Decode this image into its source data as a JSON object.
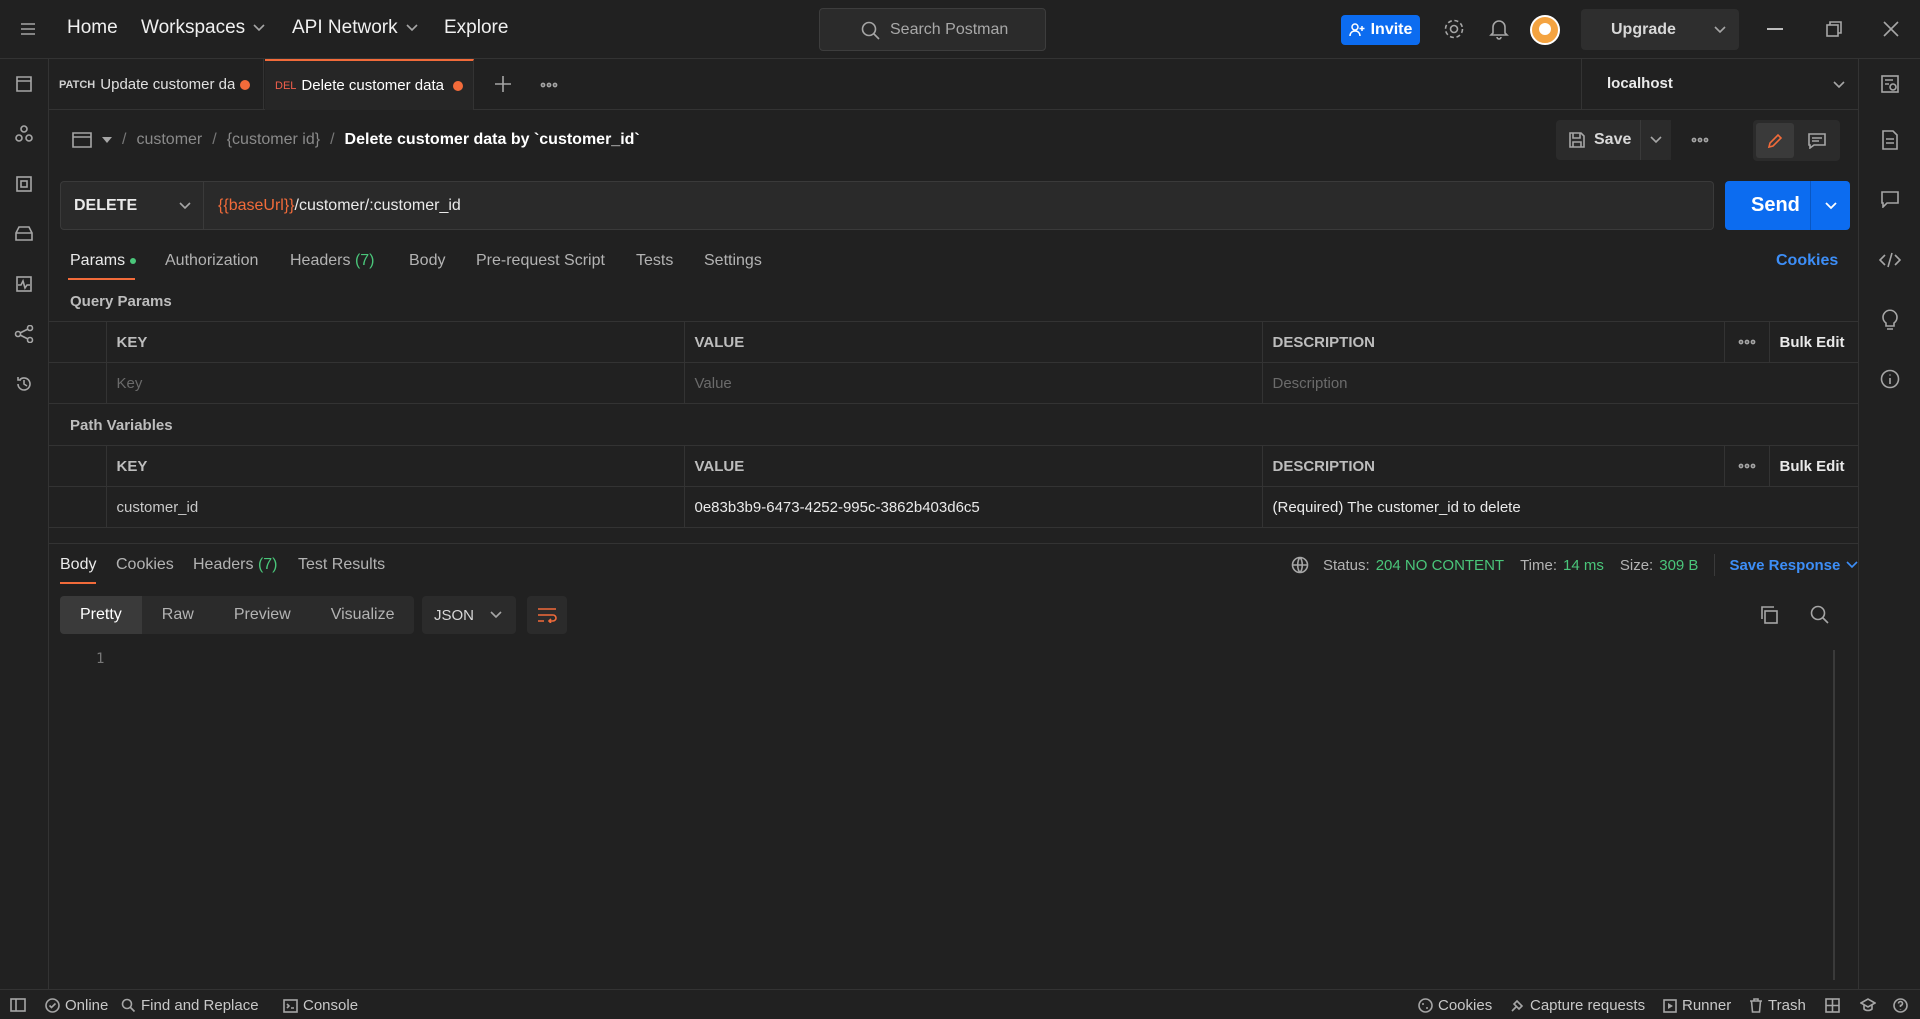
{
  "topnav": {
    "home": "Home",
    "workspaces": "Workspaces",
    "api_network": "API Network",
    "explore": "Explore",
    "search_placeholder": "Search Postman",
    "invite": "Invite",
    "upgrade": "Upgrade"
  },
  "tabs": [
    {
      "method": "PATCH",
      "title": "Update customer da",
      "method_color": "#d0d0d0"
    },
    {
      "method": "DEL",
      "title": "Delete customer data b",
      "method_color": "#f25f4c"
    }
  ],
  "environment": "localhost",
  "breadcrumb": {
    "part1": "customer",
    "part2": "{customer id}",
    "current": "Delete customer data by `customer_id`",
    "sep": "/"
  },
  "request": {
    "save_label": "Save",
    "method": "DELETE",
    "url_var": "{{baseUrl}}",
    "url_path": "/customer/:customer_id",
    "send_label": "Send"
  },
  "request_tabs": {
    "params": "Params",
    "authorization": "Authorization",
    "headers": "Headers",
    "headers_count": "(7)",
    "body": "Body",
    "prerequest": "Pre-request Script",
    "tests": "Tests",
    "settings": "Settings",
    "cookies": "Cookies"
  },
  "query_params": {
    "title": "Query Params",
    "col_key": "KEY",
    "col_value": "VALUE",
    "col_desc": "DESCRIPTION",
    "bulk_edit": "Bulk Edit",
    "key_placeholder": "Key",
    "value_placeholder": "Value",
    "desc_placeholder": "Description"
  },
  "path_vars": {
    "title": "Path Variables",
    "col_key": "KEY",
    "col_value": "VALUE",
    "col_desc": "DESCRIPTION",
    "bulk_edit": "Bulk Edit",
    "row": {
      "key": "customer_id",
      "value": "0e83b3b9-6473-4252-995c-3862b403d6c5",
      "desc": "(Required) The customer_id to delete"
    }
  },
  "response": {
    "tabs": {
      "body": "Body",
      "cookies": "Cookies",
      "headers": "Headers",
      "headers_count": "(7)",
      "test_results": "Test Results"
    },
    "status_label": "Status:",
    "status_value": "204 NO CONTENT",
    "time_label": "Time:",
    "time_value": "14 ms",
    "size_label": "Size:",
    "size_value": "309 B",
    "save_response": "Save Response",
    "views": {
      "pretty": "Pretty",
      "raw": "Raw",
      "preview": "Preview",
      "visualize": "Visualize"
    },
    "format": "JSON",
    "line_number": "1"
  },
  "statusbar": {
    "online": "Online",
    "find_replace": "Find and Replace",
    "console": "Console",
    "cookies": "Cookies",
    "capture": "Capture requests",
    "runner": "Runner",
    "trash": "Trash"
  },
  "colors": {
    "accent_orange": "#f26b3a",
    "primary_blue": "#0c6cf0",
    "success_green": "#4ac67a",
    "link_blue": "#3d8ef7"
  }
}
